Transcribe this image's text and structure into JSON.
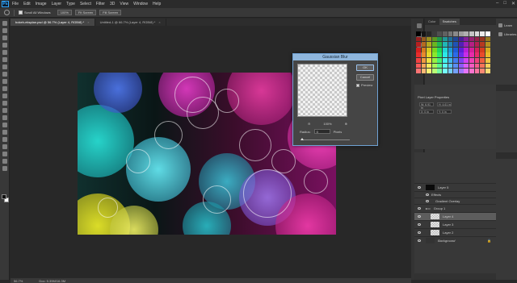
{
  "menu": [
    "File",
    "Edit",
    "Image",
    "Layer",
    "Type",
    "Select",
    "Filter",
    "3D",
    "View",
    "Window",
    "Help"
  ],
  "options": {
    "scroll_all_windows": "Scroll All Windows",
    "zoom": "100%",
    "fit_screen": "Fit Screen",
    "fill_screen": "Fill Screen"
  },
  "tabs": [
    {
      "label": "bokeh-eksplan.psd @ 56.7% (Layer 4, RGB/8) *"
    },
    {
      "label": "Untitled-1 @ 66.7% (Layer 4, RGB/8) *"
    }
  ],
  "status": {
    "zoom": "56.7%",
    "doc": "Doc: 5.39M/16.3M"
  },
  "dialog": {
    "title": "Gaussian Blur",
    "ok": "OK",
    "cancel": "Cancel",
    "preview": "Preview",
    "zoom_level": "100%",
    "radius_label": "Radius:",
    "radius_value": "0",
    "radius_unit": "Pixels"
  },
  "right_top_tabs": [
    "Color",
    "Swatches"
  ],
  "libraries": [
    "Learn",
    "Libraries"
  ],
  "props_tabs": [
    "Adjustments",
    "Properties"
  ],
  "props": {
    "title": "Pixel Layer Properties",
    "w": "W: 6.91 in",
    "h": "H: 4.61 in",
    "x": "X: 0 in",
    "y": "Y: 0 in"
  },
  "layer_tabs": [
    "Layers",
    "Channels",
    "Paths"
  ],
  "layers": [
    {
      "name": "Layer 5",
      "indent": 0
    },
    {
      "name": "Effects",
      "indent": 1
    },
    {
      "name": "Gradient Overlay",
      "indent": 2
    },
    {
      "name": "Group 1",
      "indent": 0
    },
    {
      "name": "Layer 4",
      "indent": 1
    },
    {
      "name": "Layer 3",
      "indent": 1
    },
    {
      "name": "Layer 2",
      "indent": 1
    },
    {
      "name": "Background",
      "indent": 0
    }
  ],
  "colors": {
    "accent": "#6fa2d4",
    "panel": "#383838",
    "canvas_bg": "#282828"
  }
}
